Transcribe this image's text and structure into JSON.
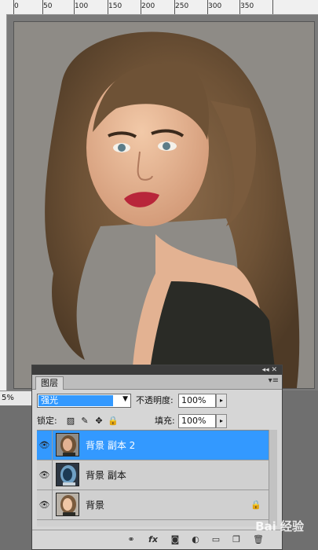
{
  "ruler": {
    "ticks": [
      "0",
      "50",
      "100",
      "150",
      "200",
      "250",
      "300",
      "350"
    ]
  },
  "status": {
    "zoom": "5%"
  },
  "layers_panel": {
    "tab_label": "图层",
    "collapse_icon": "double-chevron-icon",
    "menu_icon": "panel-menu-icon",
    "blend_mode": "强光",
    "opacity_label": "不透明度:",
    "opacity_value": "100%",
    "lock_label": "锁定:",
    "fill_label": "填充:",
    "fill_value": "100%",
    "layers": [
      {
        "name": "背景 副本 2",
        "selected": true,
        "visible": true,
        "locked": false
      },
      {
        "name": "背景 副本",
        "selected": false,
        "visible": true,
        "locked": false
      },
      {
        "name": "背景",
        "selected": false,
        "visible": true,
        "locked": true
      }
    ],
    "footer_icons": [
      "link-icon",
      "fx-icon",
      "mask-icon",
      "adjustment-icon",
      "group-icon",
      "new-layer-icon",
      "trash-icon"
    ]
  },
  "watermark": {
    "text": "Bai 经验"
  },
  "colors": {
    "selection": "#3399ff",
    "panel_bg": "#d6d6d6",
    "canvas_bg": "#8e8b86"
  }
}
